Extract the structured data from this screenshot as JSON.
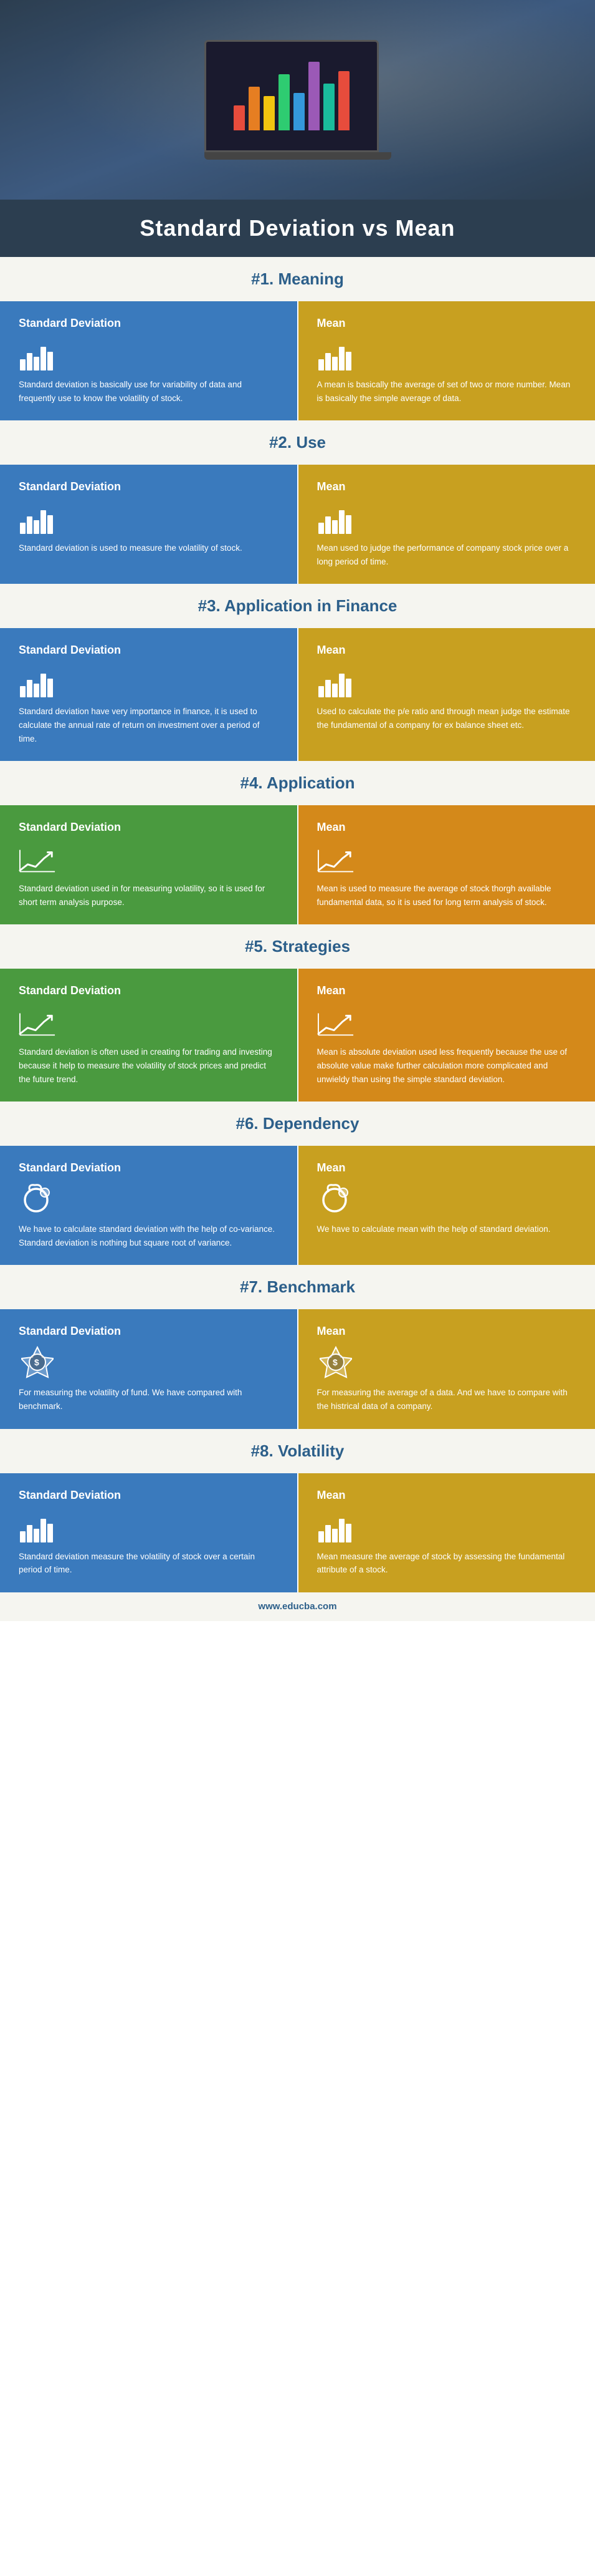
{
  "hero": {
    "alt": "Person working on laptop with financial charts"
  },
  "title": "Standard Deviation vs Mean",
  "footer_url": "www.educba.com",
  "sections": [
    {
      "id": "meaning",
      "number": "#1. Meaning",
      "left": {
        "title": "Standard Deviation",
        "icon": "bars",
        "text": "Standard deviation is basically use for variability of data and frequently use to know the volatility of stock."
      },
      "right": {
        "title": "Mean",
        "icon": "bars",
        "text": "A mean is basically the average of set of two or more number. Mean is basically the simple average of data."
      }
    },
    {
      "id": "use",
      "number": "#2. Use",
      "left": {
        "title": "Standard Deviation",
        "icon": "bars",
        "text": "Standard deviation is used to measure the volatility of stock."
      },
      "right": {
        "title": "Mean",
        "icon": "bars",
        "text": "Mean used to judge the performance of company stock price over a long period of time."
      }
    },
    {
      "id": "application-finance",
      "number": "#3. Application in Finance",
      "left": {
        "title": "Standard Deviation",
        "icon": "bars",
        "text": "Standard deviation have very importance in finance, it is used to calculate the annual rate of return on investment over a period of time."
      },
      "right": {
        "title": "Mean",
        "icon": "bars",
        "text": "Used to calculate the p/e ratio and through mean judge the estimate the fundamental of a company for ex balance sheet etc."
      }
    },
    {
      "id": "application",
      "number": "#4. Application",
      "left": {
        "title": "Standard Deviation",
        "icon": "trend",
        "text": "Standard deviation used in for measuring volatility, so it is used for short term analysis purpose."
      },
      "right": {
        "title": "Mean",
        "icon": "trend",
        "text": "Mean is used to measure the average of stock thorgh available fundamental data, so it is used for long term analysis of stock."
      }
    },
    {
      "id": "strategies",
      "number": "#5. Strategies",
      "left": {
        "title": "Standard Deviation",
        "icon": "trend",
        "text": "Standard deviation is often used in creating for trading and investing because it help to measure the volatility of stock prices and predict the future trend."
      },
      "right": {
        "title": "Mean",
        "icon": "trend",
        "text": "Mean is absolute deviation used less frequently because the use of absolute value make further calculation more complicated and unwieldy than using the simple standard deviation."
      }
    },
    {
      "id": "dependency",
      "number": "#6. Dependency",
      "left": {
        "title": "Standard Deviation",
        "icon": "circle",
        "text": "We have to calculate standard deviation with the help of co-variance. Standard deviation is nothing but square root of variance."
      },
      "right": {
        "title": "Mean",
        "icon": "circle",
        "text": "We have to calculate mean with the help of standard deviation."
      }
    },
    {
      "id": "benchmark",
      "number": "#7. Benchmark",
      "left": {
        "title": "Standard Deviation",
        "icon": "money",
        "text": "For measuring the volatility of fund. We have compared with benchmark."
      },
      "right": {
        "title": "Mean",
        "icon": "money",
        "text": "For measuring the average of a data. And we have to compare with the histrical data of a company."
      }
    },
    {
      "id": "volatility",
      "number": "#8. Volatility",
      "left": {
        "title": "Standard Deviation",
        "icon": "bars",
        "text": "Standard deviation measure the volatility of stock over a certain period of time."
      },
      "right": {
        "title": "Mean",
        "icon": "bars",
        "text": "Mean measure the average of stock by assessing the fundamental attribute of a stock."
      }
    }
  ]
}
